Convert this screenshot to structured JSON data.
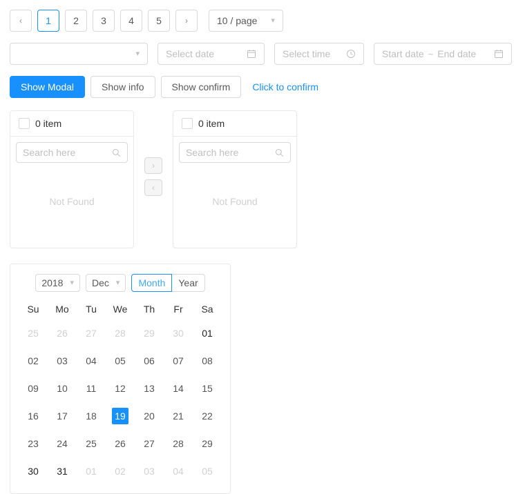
{
  "pagination": {
    "prev_label": "‹",
    "next_label": "›",
    "pages": [
      "1",
      "2",
      "3",
      "4",
      "5"
    ],
    "active_page": "1",
    "page_size_label": "10 / page",
    "accent_color": "#1890ff"
  },
  "inputs": {
    "select_placeholder": "",
    "date_placeholder": "Select date",
    "time_placeholder": "Select time",
    "range_start_placeholder": "Start date",
    "range_separator": "~",
    "range_end_placeholder": "End date"
  },
  "buttons": {
    "show_modal": "Show Modal",
    "show_info": "Show info",
    "show_confirm": "Show confirm",
    "click_to_confirm": "Click to confirm",
    "primary_color": "#1890ff",
    "link_color": "#1890ff"
  },
  "transfer": {
    "left": {
      "count_label": "0 item",
      "search_placeholder": "Search here",
      "empty_text": "Not Found"
    },
    "right": {
      "count_label": "0 item",
      "search_placeholder": "Search here",
      "empty_text": "Not Found"
    },
    "to_right_label": "›",
    "to_left_label": "‹"
  },
  "calendar": {
    "year": "2018",
    "month": "Dec",
    "mode_month_label": "Month",
    "mode_year_label": "Year",
    "active_mode": "Month",
    "selected_day": "19",
    "selected_color": "#1890ff",
    "weekdays": [
      "Su",
      "Mo",
      "Tu",
      "We",
      "Th",
      "Fr",
      "Sa"
    ],
    "weeks": [
      [
        {
          "d": "25",
          "t": "muted"
        },
        {
          "d": "26",
          "t": "muted"
        },
        {
          "d": "27",
          "t": "muted"
        },
        {
          "d": "28",
          "t": "muted"
        },
        {
          "d": "29",
          "t": "muted"
        },
        {
          "d": "30",
          "t": "muted"
        },
        {
          "d": "01",
          "t": "bold"
        }
      ],
      [
        {
          "d": "02",
          "t": "normal"
        },
        {
          "d": "03",
          "t": "normal"
        },
        {
          "d": "04",
          "t": "normal"
        },
        {
          "d": "05",
          "t": "normal"
        },
        {
          "d": "06",
          "t": "normal"
        },
        {
          "d": "07",
          "t": "normal"
        },
        {
          "d": "08",
          "t": "normal"
        }
      ],
      [
        {
          "d": "09",
          "t": "normal"
        },
        {
          "d": "10",
          "t": "normal"
        },
        {
          "d": "11",
          "t": "normal"
        },
        {
          "d": "12",
          "t": "normal"
        },
        {
          "d": "13",
          "t": "normal"
        },
        {
          "d": "14",
          "t": "normal"
        },
        {
          "d": "15",
          "t": "normal"
        }
      ],
      [
        {
          "d": "16",
          "t": "normal"
        },
        {
          "d": "17",
          "t": "normal"
        },
        {
          "d": "18",
          "t": "normal"
        },
        {
          "d": "19",
          "t": "selected"
        },
        {
          "d": "20",
          "t": "normal"
        },
        {
          "d": "21",
          "t": "normal"
        },
        {
          "d": "22",
          "t": "normal"
        }
      ],
      [
        {
          "d": "23",
          "t": "normal"
        },
        {
          "d": "24",
          "t": "normal"
        },
        {
          "d": "25",
          "t": "normal"
        },
        {
          "d": "26",
          "t": "normal"
        },
        {
          "d": "27",
          "t": "normal"
        },
        {
          "d": "28",
          "t": "normal"
        },
        {
          "d": "29",
          "t": "normal"
        }
      ],
      [
        {
          "d": "30",
          "t": "bold"
        },
        {
          "d": "31",
          "t": "bold"
        },
        {
          "d": "01",
          "t": "muted"
        },
        {
          "d": "02",
          "t": "muted"
        },
        {
          "d": "03",
          "t": "muted"
        },
        {
          "d": "04",
          "t": "muted"
        },
        {
          "d": "05",
          "t": "muted"
        }
      ]
    ]
  },
  "icons": {
    "chevron_down": "chevron-down-icon",
    "calendar": "calendar-icon",
    "clock": "clock-icon",
    "search": "search-icon"
  }
}
